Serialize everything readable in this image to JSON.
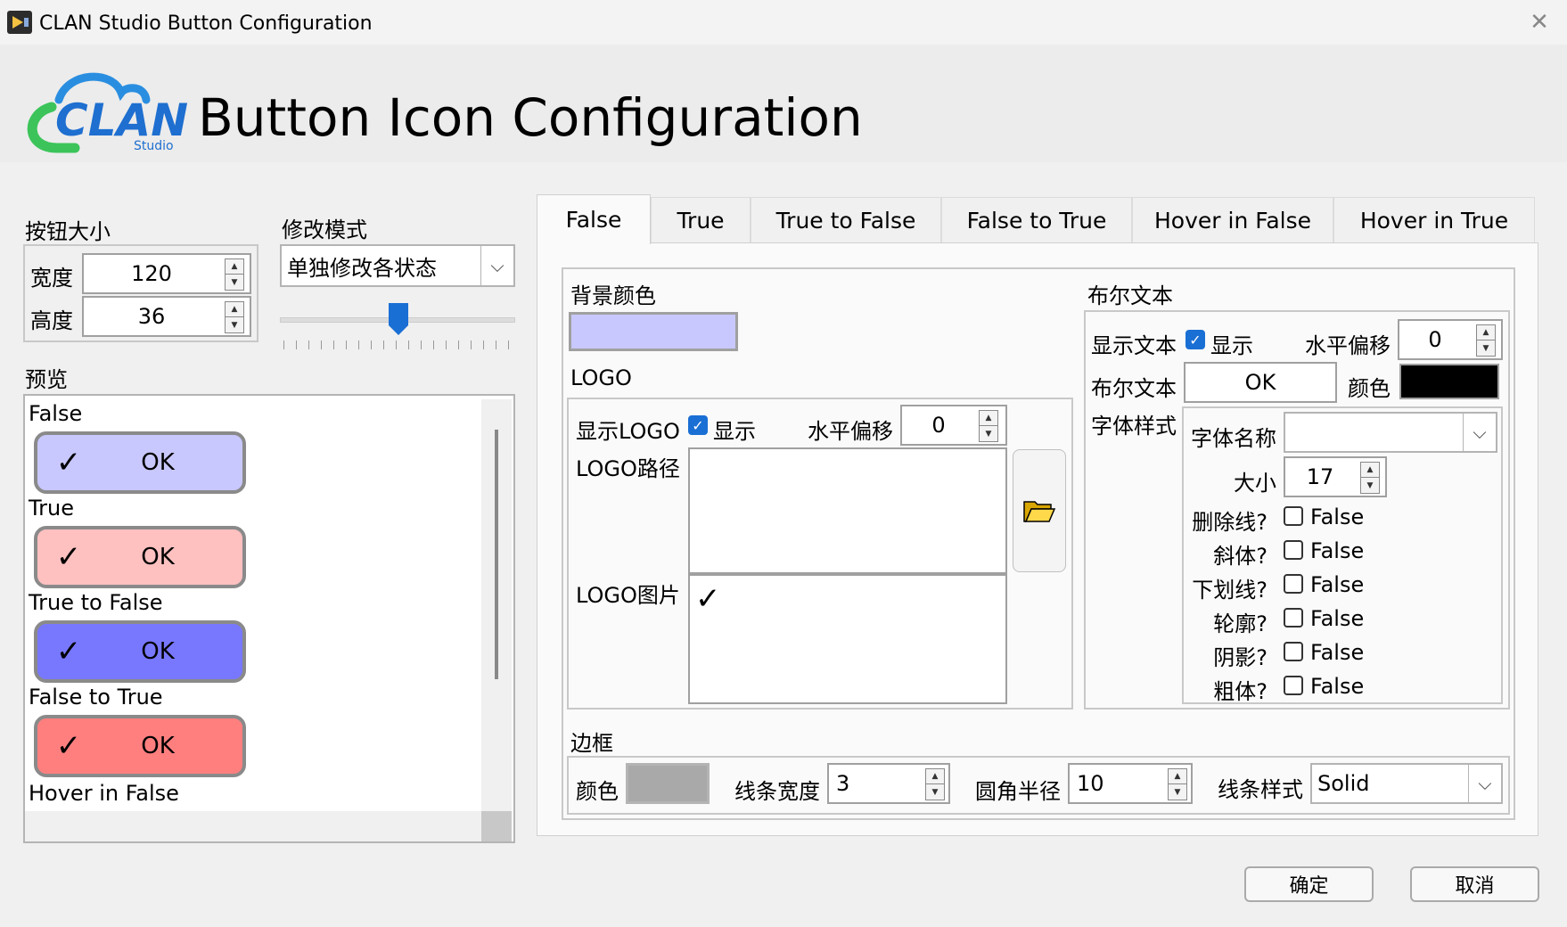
{
  "window": {
    "title": "CLAN Studio Button Configuration",
    "close_glyph": "✕"
  },
  "header": {
    "logo_text": "CLAN",
    "logo_sub": "Studio",
    "title": "Button Icon Configuration"
  },
  "size": {
    "section_label": "按钮大小",
    "width_label": "宽度",
    "width_value": "120",
    "height_label": "高度",
    "height_value": "36"
  },
  "mode": {
    "label": "修改模式",
    "value": "单独修改各状态",
    "slider_level": 0.5
  },
  "preview": {
    "label": "预览",
    "items": [
      {
        "label": "False",
        "text": "OK",
        "check": "✓",
        "color": "#c8c8ff"
      },
      {
        "label": "True",
        "text": "OK",
        "check": "✓",
        "color": "#ffc0c0"
      },
      {
        "label": "True to False",
        "text": "OK",
        "check": "✓",
        "color": "#7878ff"
      },
      {
        "label": "False to True",
        "text": "OK",
        "check": "✓",
        "color": "#ff7f7f"
      }
    ],
    "last_label": "Hover in False"
  },
  "tabs": [
    "False",
    "True",
    "True to False",
    "False to True",
    "Hover in False",
    "Hover in True"
  ],
  "bg": {
    "label": "背景颜色",
    "color": "#c8c8ff"
  },
  "logo": {
    "section_label": "LOGO",
    "show_label": "显示LOGO",
    "show_check_label": "显示",
    "show_checked": true,
    "offset_label": "水平偏移",
    "offset_value": "0",
    "path_label": "LOGO路径",
    "path_value": "",
    "image_label": "LOGO图片",
    "image_glyph": "✓",
    "folder_icon": "folder-open-icon"
  },
  "bool_text": {
    "section_label": "布尔文本",
    "show_label": "显示文本",
    "show_check_label": "显示",
    "show_checked": true,
    "offset_label": "水平偏移",
    "offset_value": "0",
    "text_label": "布尔文本",
    "text_value": "OK",
    "color_label": "颜色",
    "color": "#000000",
    "font_style_label": "字体样式",
    "font_name_label": "字体名称",
    "font_name_value": "",
    "size_label": "大小",
    "size_value": "17",
    "options": [
      {
        "label": "删除线?",
        "value": "False"
      },
      {
        "label": "斜体?",
        "value": "False"
      },
      {
        "label": "下划线?",
        "value": "False"
      },
      {
        "label": "轮廓?",
        "value": "False"
      },
      {
        "label": "阴影?",
        "value": "False"
      },
      {
        "label": "粗体?",
        "value": "False"
      }
    ]
  },
  "border": {
    "section_label": "边框",
    "color_label": "颜色",
    "color": "#a9a9a9",
    "width_label": "线条宽度",
    "width_value": "3",
    "radius_label": "圆角半径",
    "radius_value": "10",
    "style_label": "线条样式",
    "style_value": "Solid"
  },
  "dialog": {
    "ok_label": "确定",
    "cancel_label": "取消"
  }
}
